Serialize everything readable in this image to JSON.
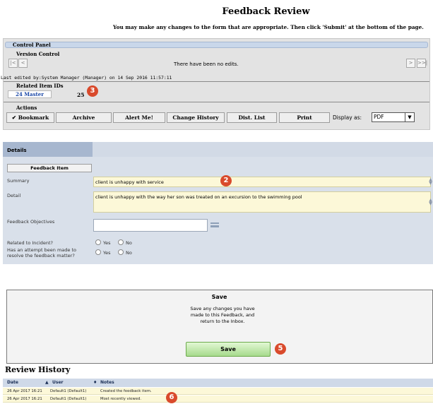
{
  "header": {
    "title": "Feedback Review",
    "subtitle": "You may make any changes to the form that are appropriate. Then click 'Submit' at the bottom of the page."
  },
  "control_panel": {
    "title": "Control Panel",
    "version_control_label": "Version Control",
    "nav": {
      "first": "|<",
      "prev": "<",
      "next": ">",
      "last": ">>|"
    },
    "edit_status": "There have been no edits.",
    "last_edited": "Last edited by:System Manager (Manager) on 14 Sep 2016 11:57:11",
    "related_label": "Related Item IDs",
    "related_tag": "24 Master",
    "related_count": "25",
    "callout": "3",
    "actions_label": "Actions",
    "actions": {
      "bookmark": "Bookmark",
      "archive": "Archive",
      "alert": "Alert Me!",
      "history": "Change History",
      "dist": "Dist. List",
      "print": "Print"
    },
    "display_as_label": "Display as:",
    "display_as_value": "PDF"
  },
  "details": {
    "tab": "Details",
    "item_button": "Feedback Item",
    "summary_label": "Summary",
    "summary_value": "client is unhappy with service",
    "summary_callout": "2",
    "detail_label": "Detail",
    "detail_value": "client is unhappy with the way her son was treated on an excursion to the swimming pool",
    "objectives_label": "Feedback Objectives",
    "objectives_value": "",
    "incident_label": "Related to Incident?",
    "attempt_label": "Has an attempt been made to resolve the feedback matter?",
    "yes": "Yes",
    "no": "No"
  },
  "save": {
    "heading": "Save",
    "description": "Save any changes you have made to this Feedback, and return to the Inbox.",
    "button": "Save",
    "callout": "5"
  },
  "review_history": {
    "title": "Review History",
    "columns": {
      "date": "Date",
      "user": "User",
      "notes": "Notes"
    },
    "sort_marks": {
      "date": "▲",
      "user": "♦"
    },
    "rows": [
      {
        "date": "26 Apr 2017 16:21",
        "user": "Default1 (Default1)",
        "notes": "Created the feedback item."
      },
      {
        "date": "26 Apr 2017 16:21",
        "user": "Default1 (Default1)",
        "notes": "Most recently viewed."
      }
    ],
    "callout": "6"
  },
  "colors": {
    "badge": "#d94a2c",
    "panel_blue": "#d9e0ea",
    "field_yellow": "#fcf8d8",
    "save_green": "#a6da8c",
    "link_blue": "#1b48a8"
  }
}
